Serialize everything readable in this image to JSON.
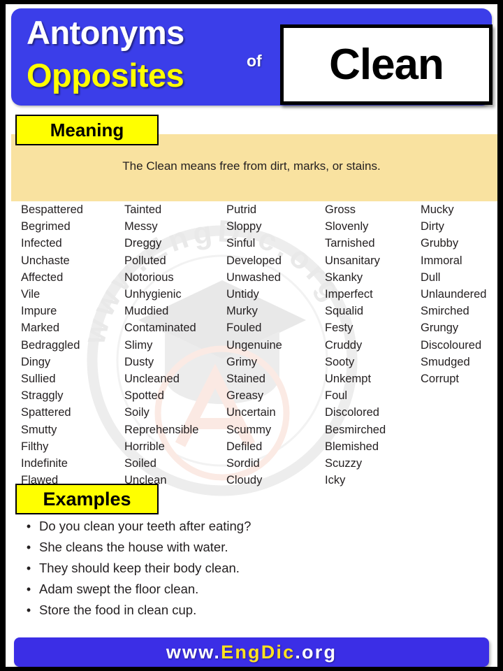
{
  "header": {
    "line1": "Antonyms",
    "line2": "Opposites",
    "connector": "of",
    "word": "Clean",
    "bg_color": "#3b3ee9",
    "line1_color": "#ffffff",
    "line2_color": "#ffff00"
  },
  "meaning": {
    "label": "Meaning",
    "text": "The Clean means free from dirt, marks, or stains.",
    "band_color": "#f9e2a0",
    "label_color": "#ffff00"
  },
  "words": {
    "col1": [
      "Bespattered",
      "Begrimed",
      "Infected",
      "Unchaste",
      "Affected",
      "Vile",
      "Impure",
      "Marked",
      "Bedraggled",
      "Dingy",
      "Sullied",
      "Straggly",
      "Spattered",
      "Smutty",
      "Filthy",
      "Indefinite",
      "Flawed"
    ],
    "col2": [
      "Tainted",
      "Messy",
      "Dreggy",
      "Polluted",
      "Notorious",
      "Unhygienic",
      "Muddied",
      "Contaminated",
      "Slimy",
      "Dusty",
      "Uncleaned",
      "Spotted",
      "Soily",
      "Reprehensible",
      "Horrible",
      "Soiled",
      "Unclean"
    ],
    "col3": [
      "Putrid",
      "Sloppy",
      "Sinful",
      "Developed",
      "Unwashed",
      "Untidy",
      "Murky",
      "Fouled",
      "Ungenuine",
      "Grimy",
      "Stained",
      "Greasy",
      "Uncertain",
      "Scummy",
      "Defiled",
      "Sordid",
      "Cloudy"
    ],
    "col4": [
      "Gross",
      "Slovenly",
      "Tarnished",
      "Unsanitary",
      "Skanky",
      "Imperfect",
      "Squalid",
      "Festy",
      "Cruddy",
      "Sooty",
      "Unkempt",
      "Foul",
      "Discolored",
      "Besmirched",
      "Blemished",
      "Scuzzy",
      "Icky"
    ],
    "col5": [
      "Mucky",
      "Dirty",
      "Grubby",
      "Immoral",
      "Dull",
      "Unlaundered",
      "Smirched",
      "Grungy",
      "Discoloured",
      "Smudged",
      "Corrupt"
    ]
  },
  "examples": {
    "label": "Examples",
    "bullet": "•",
    "items": [
      "Do you clean your teeth after eating?",
      "She cleans the house with water.",
      "They should keep their body clean.",
      "Adam swept the floor clean.",
      "Store the food in clean cup."
    ]
  },
  "footer": {
    "prefix": "www.",
    "brand": "EngDic",
    "suffix": ".org",
    "bg_color": "#3b2ee6",
    "brand_color": "#ffe21f"
  },
  "watermark": {
    "text": "www.EngDic.org",
    "color": "#ededed"
  }
}
